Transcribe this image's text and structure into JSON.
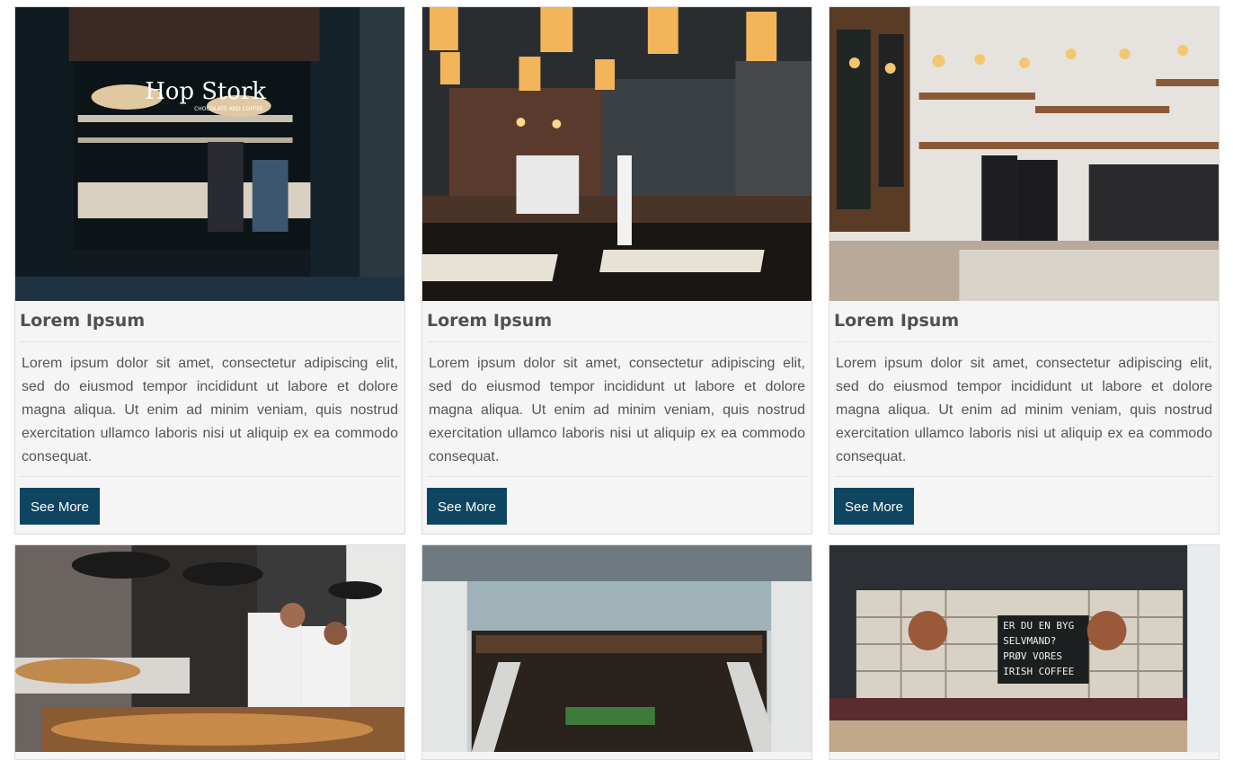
{
  "cards": [
    {
      "title": "Lorem Ipsum",
      "text": "Lorem ipsum dolor sit amet, consectetur adipiscing elit, sed do eiusmod tempor incididunt ut labore et dolore magna aliqua. Ut enim ad minim veniam, quis nostrud exercitation ullamco laboris nisi ut aliquip ex ea commodo consequat.",
      "button": "See More",
      "sign": "Hop Stork",
      "sign_sub": "CHOCOLATE AND COFFEE"
    },
    {
      "title": "Lorem Ipsum",
      "text": "Lorem ipsum dolor sit amet, consectetur adipiscing elit, sed do eiusmod tempor incididunt ut labore et dolore magna aliqua. Ut enim ad minim veniam, quis nostrud exercitation ullamco laboris nisi ut aliquip ex ea commodo consequat.",
      "button": "See More"
    },
    {
      "title": "Lorem Ipsum",
      "text": "Lorem ipsum dolor sit amet, consectetur adipiscing elit, sed do eiusmod tempor incididunt ut labore et dolore magna aliqua. Ut enim ad minim veniam, quis nostrud exercitation ullamco laboris nisi ut aliquip ex ea commodo consequat.",
      "button": "See More"
    },
    {},
    {},
    {
      "chalkboard": [
        "ER DU EN BYG",
        "SELVMAND?",
        "PRØV VORES",
        "IRISH COFFEE"
      ]
    }
  ],
  "colors": {
    "button": "#0e4560",
    "card_bg": "#f5f5f5",
    "title": "#505050"
  }
}
